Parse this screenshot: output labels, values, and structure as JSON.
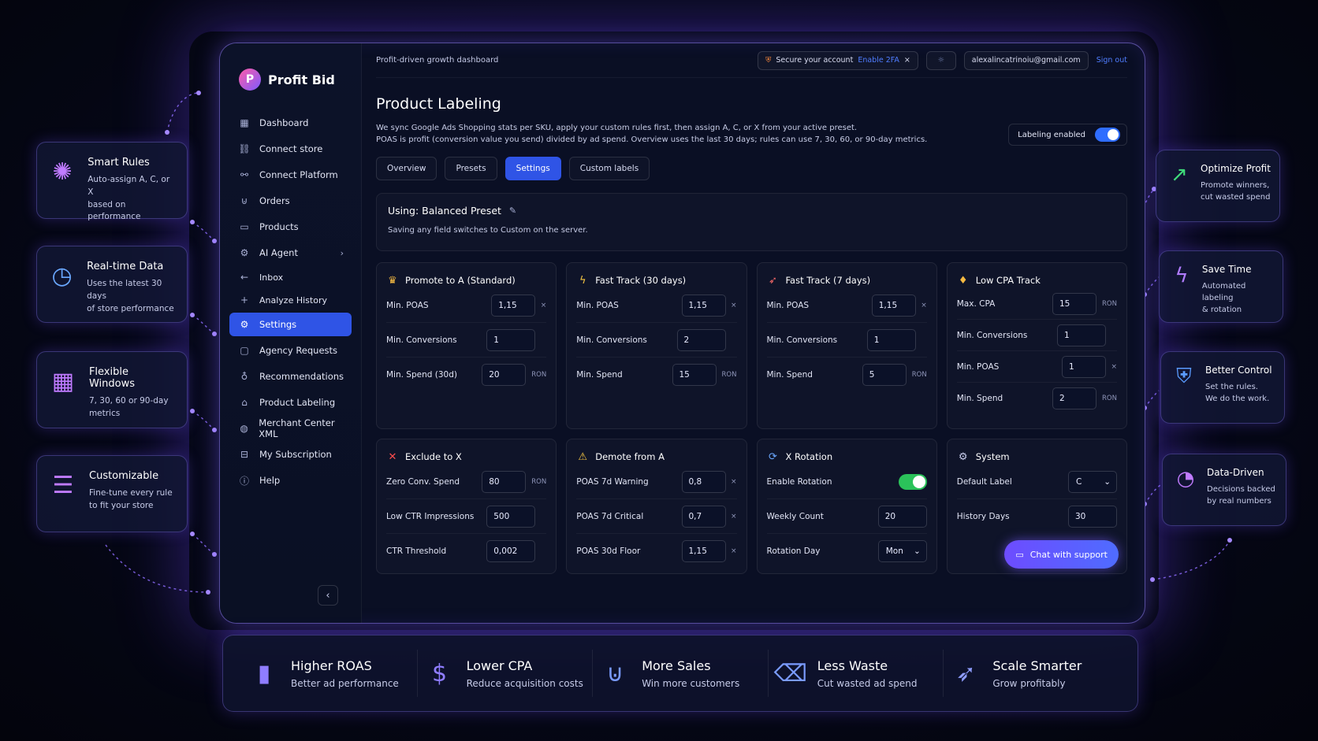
{
  "app": {
    "name": "Profit Bid",
    "logo_letter": "P"
  },
  "sidebar": {
    "items": [
      {
        "label": "Dashboard",
        "icon": "grid-icon"
      },
      {
        "label": "Connect store",
        "icon": "link-icon"
      },
      {
        "label": "Connect Platform",
        "icon": "plug-icon"
      },
      {
        "label": "Orders",
        "icon": "cart-icon"
      },
      {
        "label": "Products",
        "icon": "box-icon"
      },
      {
        "label": "AI Agent",
        "icon": "gear-icon"
      },
      {
        "label": "Inbox",
        "icon": "arrow-left-icon"
      },
      {
        "label": "Analyze History",
        "icon": "plus-icon"
      },
      {
        "label": "Settings",
        "icon": "settings-icon"
      },
      {
        "label": "Agency Requests",
        "icon": "folder-icon"
      },
      {
        "label": "Recommendations",
        "icon": "bulb-icon"
      },
      {
        "label": "Product Labeling",
        "icon": "tag-icon"
      },
      {
        "label": "Merchant Center XML",
        "icon": "globe-icon"
      },
      {
        "label": "My Subscription",
        "icon": "wallet-icon"
      },
      {
        "label": "Help",
        "icon": "help-icon"
      }
    ]
  },
  "header": {
    "subtitle": "Profit-driven growth dashboard",
    "secure_text": "Secure your account",
    "enable_2fa": "Enable 2FA",
    "close": "×",
    "email": "alexalincatrinoiu@gmail.com",
    "signout": "Sign out"
  },
  "page": {
    "title": "Product Labeling",
    "desc_line1": "We sync Google Ads Shopping stats per SKU, apply your custom rules first, then assign A, C, or X from your active preset.",
    "desc_line2": "POAS is profit (conversion value you send) divided by ad spend. Overview uses the last 30 days; rules can use 7, 30, 60, or 90-day metrics.",
    "labeling_enabled": "Labeling enabled"
  },
  "tabs": [
    "Overview",
    "Presets",
    "Settings",
    "Custom labels"
  ],
  "preset": {
    "title": "Using: Balanced Preset",
    "subtitle": "Saving any field switches to Custom on the server."
  },
  "cards": {
    "promote": {
      "title": "Promote to A (Standard)",
      "rows": [
        {
          "label": "Min. POAS",
          "value": "1,15",
          "suffix": "×"
        },
        {
          "label": "Min. Conversions",
          "value": "1",
          "suffix": ""
        },
        {
          "label": "Min. Spend (30d)",
          "value": "20",
          "suffix": "RON"
        }
      ]
    },
    "fast30": {
      "title": "Fast Track (30 days)",
      "rows": [
        {
          "label": "Min. POAS",
          "value": "1,15",
          "suffix": "×"
        },
        {
          "label": "Min. Conversions",
          "value": "2",
          "suffix": ""
        },
        {
          "label": "Min. Spend",
          "value": "15",
          "suffix": "RON"
        }
      ]
    },
    "fast7": {
      "title": "Fast Track (7 days)",
      "rows": [
        {
          "label": "Min. POAS",
          "value": "1,15",
          "suffix": "×"
        },
        {
          "label": "Min. Conversions",
          "value": "1",
          "suffix": ""
        },
        {
          "label": "Min. Spend",
          "value": "5",
          "suffix": "RON"
        }
      ]
    },
    "lowcpa": {
      "title": "Low CPA Track",
      "rows": [
        {
          "label": "Max. CPA",
          "value": "15",
          "suffix": "RON"
        },
        {
          "label": "Min. Conversions",
          "value": "1",
          "suffix": ""
        },
        {
          "label": "Min. POAS",
          "value": "1",
          "suffix": "×"
        },
        {
          "label": "Min. Spend",
          "value": "2",
          "suffix": "RON"
        }
      ]
    },
    "exclude": {
      "title": "Exclude to X",
      "rows": [
        {
          "label": "Zero Conv. Spend",
          "value": "80",
          "suffix": "RON"
        },
        {
          "label": "Low CTR Impressions",
          "value": "500",
          "suffix": ""
        },
        {
          "label": "CTR Threshold",
          "value": "0,002",
          "suffix": ""
        }
      ]
    },
    "demote": {
      "title": "Demote from A",
      "rows": [
        {
          "label": "POAS 7d Warning",
          "value": "0,8",
          "suffix": "×"
        },
        {
          "label": "POAS 7d Critical",
          "value": "0,7",
          "suffix": "×"
        },
        {
          "label": "POAS 30d Floor",
          "value": "1,15",
          "suffix": "×"
        }
      ]
    },
    "rotation": {
      "title": "X Rotation",
      "enable_label": "Enable Rotation",
      "weekly_label": "Weekly Count",
      "weekly_value": "20",
      "day_label": "Rotation Day",
      "day_value": "Mon"
    },
    "system": {
      "title": "System",
      "default_label": "Default Label",
      "default_value": "C",
      "history_label": "History Days",
      "history_value": "30"
    }
  },
  "chat": {
    "label": "Chat with support"
  },
  "features_left": [
    {
      "title": "Smart Rules",
      "desc1": "Auto-assign A, C, or X",
      "desc2": "based on performance",
      "icon": "brain-icon"
    },
    {
      "title": "Real-time Data",
      "desc1": "Uses the latest 30 days",
      "desc2": "of store performance",
      "icon": "clock-icon"
    },
    {
      "title": "Flexible Windows",
      "desc1": "7, 30, 60 or 90-day",
      "desc2": "metrics",
      "icon": "calendar-icon"
    },
    {
      "title": "Customizable",
      "desc1": "Fine-tune every rule",
      "desc2": "to fit your store",
      "icon": "sliders-icon"
    }
  ],
  "features_right": [
    {
      "title": "Optimize Profit",
      "desc1": "Promote winners,",
      "desc2": "cut wasted spend",
      "icon": "chart-up-icon"
    },
    {
      "title": "Save Time",
      "desc1": "Automated labeling",
      "desc2": "& rotation",
      "icon": "bolt-icon"
    },
    {
      "title": "Better Control",
      "desc1": "Set the rules.",
      "desc2": "We do the work.",
      "icon": "shield-icon"
    },
    {
      "title": "Data-Driven",
      "desc1": "Decisions backed",
      "desc2": "by real numbers",
      "icon": "pie-icon"
    }
  ],
  "stats": [
    {
      "title": "Higher ROAS",
      "desc": "Better ad performance",
      "icon": "bar-chart-icon"
    },
    {
      "title": "Lower CPA",
      "desc": "Reduce acquisition costs",
      "icon": "money-bag-icon"
    },
    {
      "title": "More Sales",
      "desc": "Win more customers",
      "icon": "cart-icon"
    },
    {
      "title": "Less Waste",
      "desc": "Cut wasted ad spend",
      "icon": "trash-icon"
    },
    {
      "title": "Scale Smarter",
      "desc": "Grow profitably",
      "icon": "rocket-icon"
    }
  ],
  "colors": {
    "accent": "#2f54e6",
    "link": "#4f7cff",
    "glow": "#7d5bff",
    "toggle_green": "#2bc25a"
  }
}
